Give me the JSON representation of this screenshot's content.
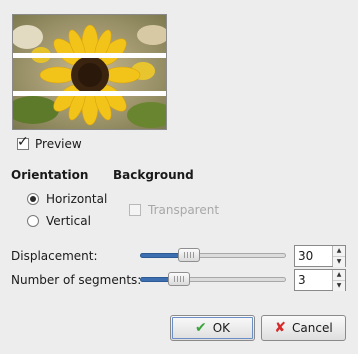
{
  "preview": {
    "image_alt": "sunflower preview with blind stripes",
    "label": "Preview",
    "checked": true
  },
  "orientation": {
    "heading": "Orientation",
    "options": [
      {
        "label": "Horizontal",
        "selected": true
      },
      {
        "label": "Vertical",
        "selected": false
      }
    ]
  },
  "background": {
    "heading": "Background",
    "transparent_label": "Transparent",
    "transparent_checked": false,
    "enabled": false
  },
  "displacement": {
    "label": "Displacement:",
    "value": "30",
    "fraction": 0.3
  },
  "segments": {
    "label": "Number of segments:",
    "value": "3",
    "fraction": 0.22
  },
  "buttons": {
    "ok": "OK",
    "cancel": "Cancel"
  },
  "colors": {
    "accent": "#3d6fb0",
    "ok_icon": "#3aa53a",
    "cancel_icon": "#d62a2a"
  }
}
